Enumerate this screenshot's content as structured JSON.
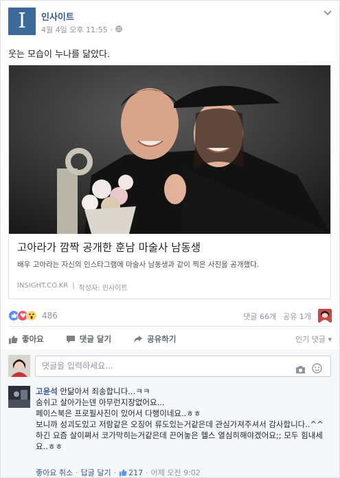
{
  "post": {
    "page_name": "인사이트",
    "logo_letter": "I",
    "timestamp": "4월 4일 오후 11:55",
    "separator": "·",
    "message": "웃는 모습이 누나를 닮았다."
  },
  "link": {
    "title": "고아라가 깜짝 공개한 훈남 마술사 남동생",
    "description": "배우 고아라는 자신의 인스타그램에 마술사 남동생과 같이 찍은 사진을 공개했다.",
    "domain": "INSIGHT.CO.KR",
    "sep": "|",
    "author": "작성자: 인사이트"
  },
  "reactions": {
    "count": "486",
    "comments": "댓글 66개",
    "shares": "공유 1개",
    "icons": [
      "like-icon",
      "love-icon",
      "wow-icon"
    ],
    "colors": {
      "like": "#5890ff",
      "love": "#f25268",
      "wow": "#fcd669"
    }
  },
  "actions": {
    "like": "좋아요",
    "comment": "댓글 달기",
    "share": "공유하기",
    "sort": "인기 댓글 ▾"
  },
  "composer": {
    "placeholder": "댓글을 입력하세요..."
  },
  "comment": {
    "author": "고윤석",
    "line1": "안닮아서 죄송합니다...ㅋㅋ",
    "line2": "숨쉬고 살아가는덴 아무런지장없어요...",
    "line3": "페이스북은 프로필사진이 있어서 다행이네요..ㅎㅎ",
    "line4": "보니까 성괴도있고 저랑같은 오징어 류도있는거같은데 관심가져주셔서 감사합니다..^^",
    "line5": "하긴 요즘 살이쪄서 코가막히는거같은데 끈어놓은 헬스 열심히해야겠어요;; 모두 힘내세요..ㅎㅎ",
    "like": "좋아요 취소",
    "dot": "·",
    "reply": "답글 달기",
    "likes": "217",
    "time": "어제 오전 9:02"
  }
}
